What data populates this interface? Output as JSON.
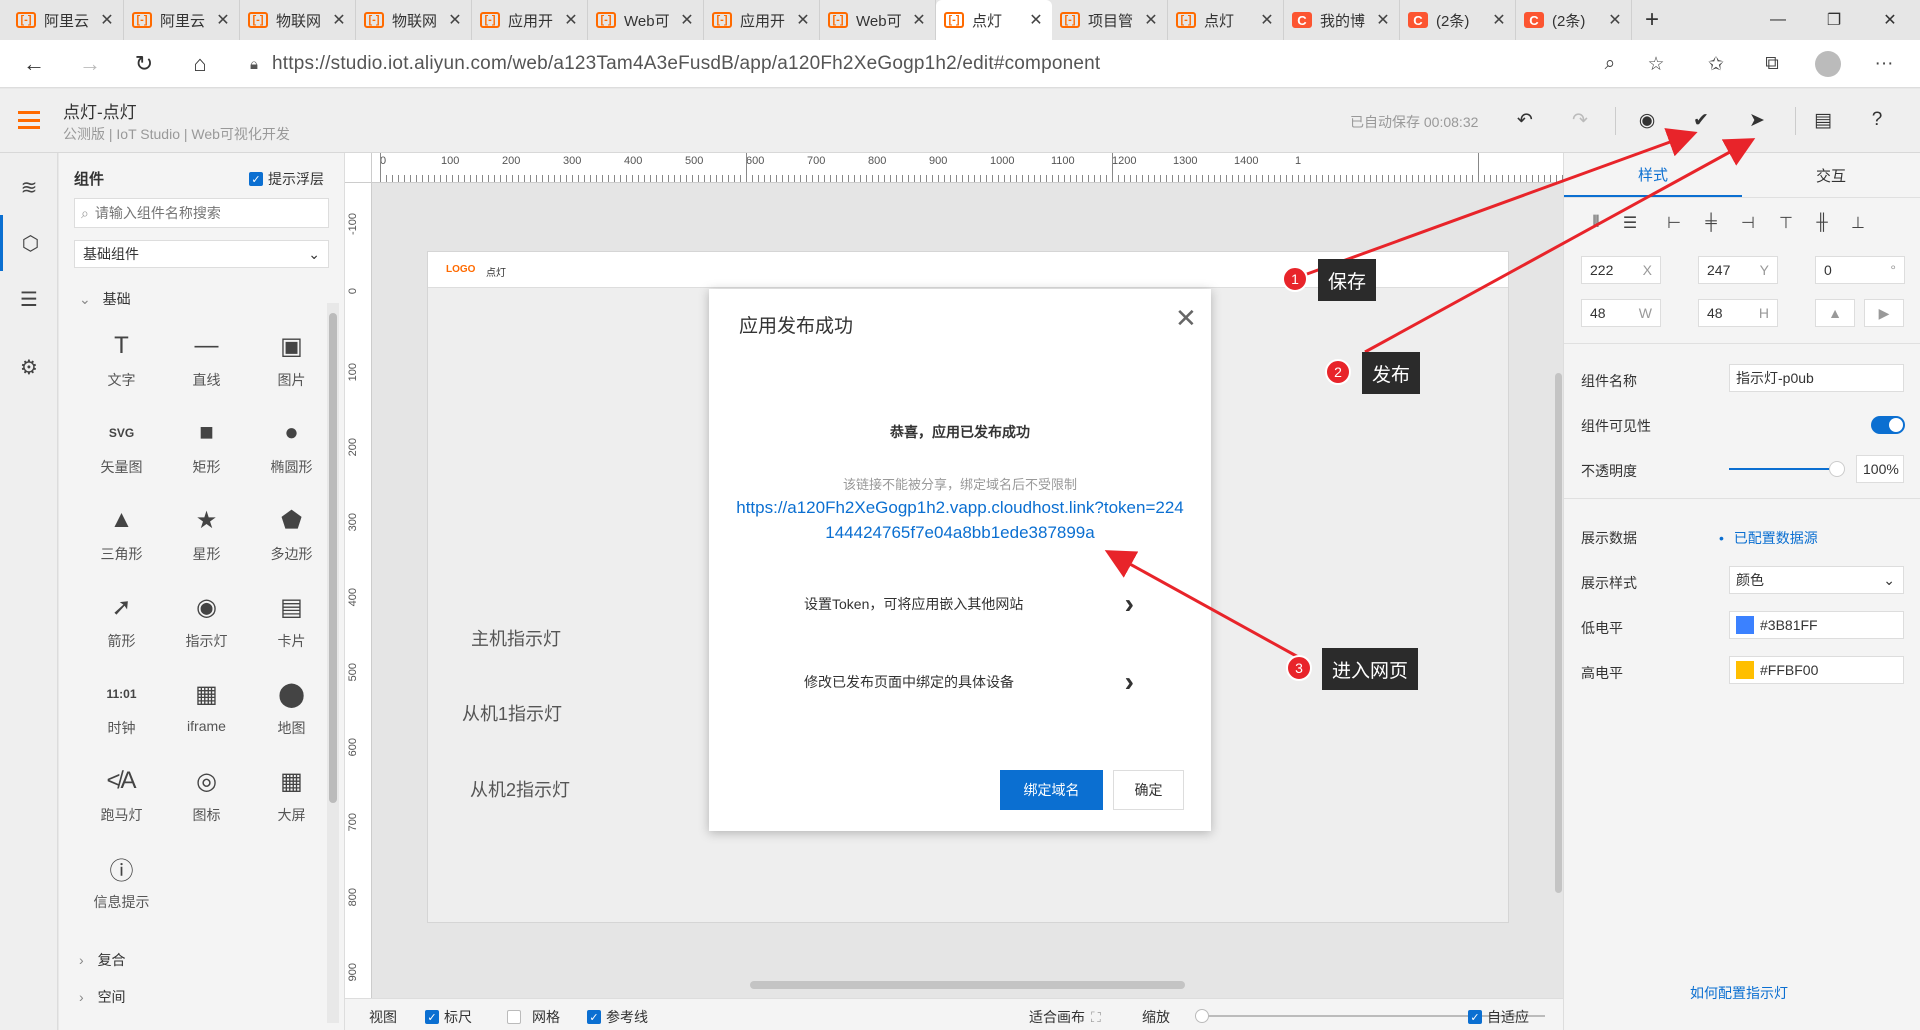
{
  "browser": {
    "tabs": [
      {
        "title": "阿里云",
        "icon": "aliyun-icon",
        "active": false
      },
      {
        "title": "阿里云",
        "icon": "aliyun-icon",
        "active": false
      },
      {
        "title": "物联网",
        "icon": "aliyun-icon",
        "active": false
      },
      {
        "title": "物联网",
        "icon": "aliyun-icon",
        "active": false
      },
      {
        "title": "应用开",
        "icon": "aliyun-icon",
        "active": false
      },
      {
        "title": "Web可",
        "icon": "aliyun-icon",
        "active": false
      },
      {
        "title": "应用开",
        "icon": "aliyun-icon",
        "active": false
      },
      {
        "title": "Web可",
        "icon": "aliyun-icon",
        "active": false
      },
      {
        "title": "点灯",
        "icon": "aliyun-icon",
        "active": true
      },
      {
        "title": "项目管",
        "icon": "aliyun-icon",
        "active": false
      },
      {
        "title": "点灯",
        "icon": "aliyun-icon",
        "active": false
      },
      {
        "title": "我的博",
        "icon": "csdn-icon",
        "active": false
      },
      {
        "title": "(2条)",
        "icon": "csdn-icon",
        "active": false
      },
      {
        "title": "(2条)",
        "icon": "csdn-icon",
        "active": false
      }
    ],
    "tab_icon_aliyun": "[-]",
    "tab_icon_csdn": "C",
    "close_glyph": "✕",
    "new_tab_glyph": "+",
    "url": "https://studio.iot.aliyun.com/web/a123Tam4A3eFusdB/app/a120Fh2XeGogp1h2/edit#component"
  },
  "app": {
    "title": "点灯-点灯",
    "subtitle": "公测版 | IoT Studio | Web可视化开发",
    "autosave": "已自动保存 00:08:32"
  },
  "components": {
    "title": "组件",
    "float_label": "提示浮层",
    "search_placeholder": "请输入组件名称搜索",
    "category": "基础组件",
    "group_basic": "基础",
    "items": [
      {
        "label": "文字",
        "icon": "text-icon",
        "glyph": "T"
      },
      {
        "label": "直线",
        "icon": "line-icon",
        "glyph": "—"
      },
      {
        "label": "图片",
        "icon": "image-icon",
        "glyph": "▣"
      },
      {
        "label": "矢量图",
        "icon": "svg-icon",
        "glyph": "SVG"
      },
      {
        "label": "矩形",
        "icon": "rectangle-icon",
        "glyph": "■"
      },
      {
        "label": "椭圆形",
        "icon": "ellipse-icon",
        "glyph": "●"
      },
      {
        "label": "三角形",
        "icon": "triangle-icon",
        "glyph": "▲"
      },
      {
        "label": "星形",
        "icon": "star-icon",
        "glyph": "★"
      },
      {
        "label": "多边形",
        "icon": "polygon-icon",
        "glyph": "⬟"
      },
      {
        "label": "箭形",
        "icon": "arrow-icon",
        "glyph": "➚"
      },
      {
        "label": "指示灯",
        "icon": "indicator-icon",
        "glyph": "◉"
      },
      {
        "label": "卡片",
        "icon": "card-icon",
        "glyph": "▤"
      },
      {
        "label": "时钟",
        "icon": "clock-icon",
        "glyph": "11:01"
      },
      {
        "label": "iframe",
        "icon": "iframe-icon",
        "glyph": "▦"
      },
      {
        "label": "地图",
        "icon": "map-pin-icon",
        "glyph": "⬤"
      },
      {
        "label": "跑马灯",
        "icon": "marquee-icon",
        "glyph": "≮A"
      },
      {
        "label": "图标",
        "icon": "icon-component-icon",
        "glyph": "◎"
      },
      {
        "label": "大屏",
        "icon": "bigscreen-icon",
        "glyph": "▦"
      },
      {
        "label": "信息提示",
        "icon": "info-icon",
        "glyph": "ⓘ"
      }
    ],
    "group_composite": "复合",
    "group_space": "空间"
  },
  "canvas": {
    "ruler_top": [
      "0",
      "100",
      "200",
      "300",
      "400",
      "500",
      "600",
      "700",
      "800",
      "900",
      "1000",
      "1100",
      "1200",
      "1300",
      "1400",
      "1"
    ],
    "ruler_left": [
      "-100",
      "0",
      "100",
      "200",
      "300",
      "400",
      "500",
      "600",
      "700",
      "800",
      "900"
    ],
    "page_logo": "LOGO",
    "page_name": "点灯",
    "lights": [
      {
        "label": "主机指示灯"
      },
      {
        "label": "从机1指示灯"
      },
      {
        "label": "从机2指示灯"
      }
    ],
    "bottom": {
      "view": "视图",
      "ruler": "标尺",
      "grid": "网格",
      "guides": "参考线",
      "fit": "适合画布",
      "zoom": "缩放",
      "adaptive": "自适应"
    }
  },
  "props": {
    "tab_style": "样式",
    "tab_interact": "交互",
    "x": "222",
    "x_label": "X",
    "y": "247",
    "y_label": "Y",
    "rot": "0",
    "rot_label": "°",
    "w": "48",
    "w_label": "W",
    "h": "48",
    "h_label": "H",
    "name_label": "组件名称",
    "name_value": "指示灯-p0ub",
    "visible_label": "组件可见性",
    "opacity_label": "不透明度",
    "opacity_value": "100%",
    "data_label": "展示数据",
    "data_value": "已配置数据源",
    "style_label": "展示样式",
    "style_value": "颜色",
    "low_label": "低电平",
    "low_value": "#3B81FF",
    "low_color": "#3B81FF",
    "high_label": "高电平",
    "high_value": "#FFBF00",
    "high_color": "#FFBF00",
    "help": "如何配置指示灯"
  },
  "modal": {
    "title": "应用发布成功",
    "congrats": "恭喜，应用已发布成功",
    "hint": "该链接不能被分享，绑定域名后不受限制",
    "link": "https://a120Fh2XeGogp1h2.vapp.cloudhost.link?token=224144424765f7e04a8bb1ede387899a",
    "row1": "设置Token，可将应用嵌入其他网站",
    "row2": "修改已发布页面中绑定的具体设备",
    "bind_btn": "绑定域名",
    "ok_btn": "确定"
  },
  "annotations": [
    {
      "num": "1",
      "text": "保存"
    },
    {
      "num": "2",
      "text": "发布"
    },
    {
      "num": "3",
      "text": "进入网页"
    }
  ],
  "colors": {
    "accent": "#0b6fd1",
    "brand": "#ff6a00",
    "arrow": "#e8242a"
  }
}
